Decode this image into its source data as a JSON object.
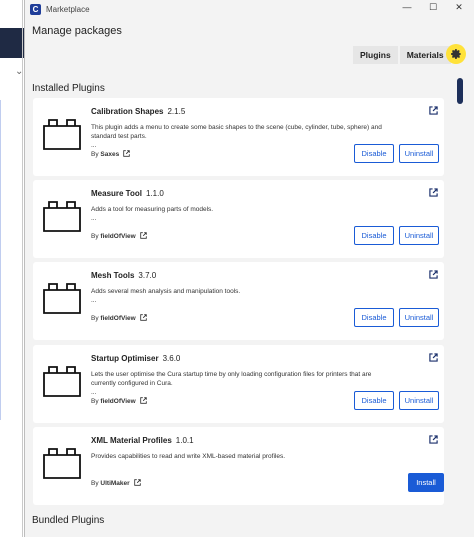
{
  "window": {
    "title": "Marketplace",
    "app_icon_letter": "C",
    "controls": {
      "minimize": "—",
      "maximize": "☐",
      "close": "✕"
    }
  },
  "header": {
    "title": "Manage packages",
    "tabs": [
      {
        "label": "Plugins"
      },
      {
        "label": "Materials"
      }
    ],
    "settings_icon": "gear-icon",
    "settings_highlight_color": "#ffe23a"
  },
  "sections": {
    "installed": "Installed Plugins",
    "bundled": "Bundled Plugins"
  },
  "plugins": [
    {
      "name": "Calibration Shapes",
      "version": "2.1.5",
      "description": "This plugin adds a menu to create some basic shapes to the scene (cube, cylinder, tube, sphere) and standard test parts.",
      "more": "...",
      "by": "By",
      "author": "Saxes",
      "actions": [
        "Disable",
        "Uninstall"
      ]
    },
    {
      "name": "Measure Tool",
      "version": "1.1.0",
      "description": "Adds a tool for measuring parts of models.",
      "more": "...",
      "by": "By",
      "author": "fieldOfView",
      "actions": [
        "Disable",
        "Uninstall"
      ]
    },
    {
      "name": "Mesh Tools",
      "version": "3.7.0",
      "description": "Adds several mesh analysis and manipulation tools.",
      "more": "...",
      "by": "By",
      "author": "fieldOfView",
      "actions": [
        "Disable",
        "Uninstall"
      ]
    },
    {
      "name": "Startup Optimiser",
      "version": "3.6.0",
      "description": "Lets the user optimise the Cura startup time by only loading configuration files for printers that are currently configured in Cura.",
      "more": "...",
      "by": "By",
      "author": "fieldOfView",
      "actions": [
        "Disable",
        "Uninstall"
      ]
    },
    {
      "name": "XML Material Profiles",
      "version": "1.0.1",
      "description": "Provides capabilities to read and write XML-based material profiles.",
      "more": "",
      "by": "By",
      "author": "UltiMaker",
      "actions": [
        "Install"
      ]
    }
  ],
  "colors": {
    "accent": "#1a5bd6",
    "scrollbar": "#1d2f5a",
    "window_bg": "#f3f3f3",
    "card_bg": "#ffffff"
  }
}
